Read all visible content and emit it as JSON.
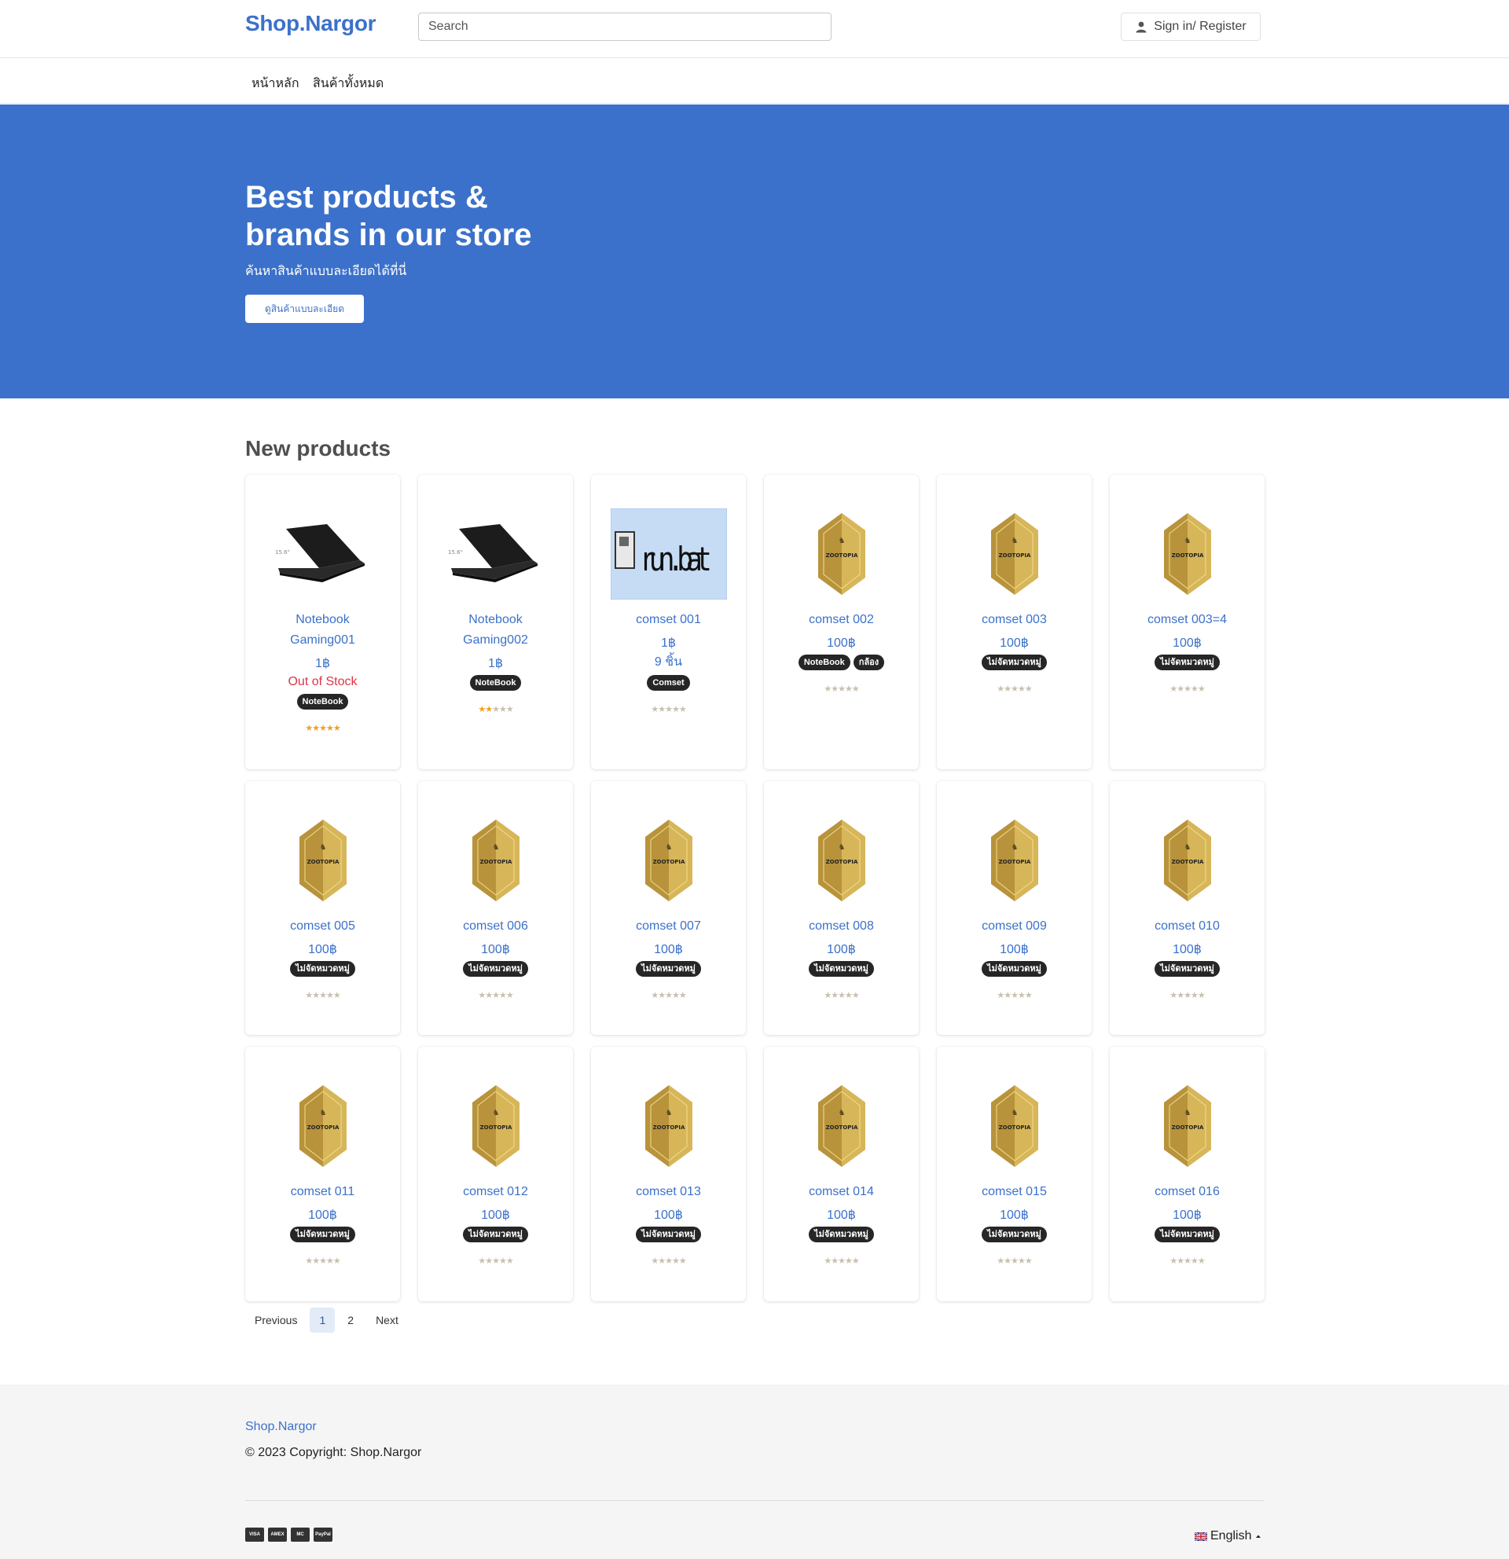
{
  "header": {
    "brand": "Shop.Nargor",
    "search_placeholder": "Search",
    "signin_label": "Sign in/ Register"
  },
  "nav": {
    "items": [
      "หน้าหลัก",
      "สินค้าทั้งหมด"
    ]
  },
  "hero": {
    "title": "Best products & brands in our store",
    "subtitle": "ค้นหาสินค้าแบบละเอียดได้ที่นี่",
    "cta_label": "ดูสินค้าแบบละเอียด"
  },
  "products": {
    "title": "New products",
    "items": [
      {
        "name": "Notebook Gaming001",
        "price": "1฿",
        "status": "Out of Stock",
        "tags": [
          "NoteBook"
        ],
        "rating": 5,
        "image": "laptop-image"
      },
      {
        "name": "Notebook Gaming002",
        "price": "1฿",
        "tags": [
          "NoteBook"
        ],
        "rating": 2,
        "image": "laptop-image"
      },
      {
        "name": "comset 001",
        "price": "1฿",
        "qty": "9 ชิ้น",
        "tags": [
          "Comset"
        ],
        "rating": 0,
        "image": "run-bat-image",
        "image_text": "run.bat"
      },
      {
        "name": "comset 002",
        "price": "100฿",
        "tags": [
          "NoteBook",
          "กล้อง"
        ],
        "rating": 0,
        "image": "zootopia-badge-image"
      },
      {
        "name": "comset 003",
        "price": "100฿",
        "tags": [
          "ไม่จัดหมวดหมู่"
        ],
        "rating": 0,
        "image": "zootopia-badge-image"
      },
      {
        "name": "comset 003=4",
        "price": "100฿",
        "tags": [
          "ไม่จัดหมวดหมู่"
        ],
        "rating": 0,
        "image": "zootopia-badge-image"
      },
      {
        "name": "comset 005",
        "price": "100฿",
        "tags": [
          "ไม่จัดหมวดหมู่"
        ],
        "rating": 0,
        "image": "zootopia-badge-image"
      },
      {
        "name": "comset 006",
        "price": "100฿",
        "tags": [
          "ไม่จัดหมวดหมู่"
        ],
        "rating": 0,
        "image": "zootopia-badge-image"
      },
      {
        "name": "comset 007",
        "price": "100฿",
        "tags": [
          "ไม่จัดหมวดหมู่"
        ],
        "rating": 0,
        "image": "zootopia-badge-image"
      },
      {
        "name": "comset 008",
        "price": "100฿",
        "tags": [
          "ไม่จัดหมวดหมู่"
        ],
        "rating": 0,
        "image": "zootopia-badge-image"
      },
      {
        "name": "comset 009",
        "price": "100฿",
        "tags": [
          "ไม่จัดหมวดหมู่"
        ],
        "rating": 0,
        "image": "zootopia-badge-image"
      },
      {
        "name": "comset 010",
        "price": "100฿",
        "tags": [
          "ไม่จัดหมวดหมู่"
        ],
        "rating": 0,
        "image": "zootopia-badge-image"
      },
      {
        "name": "comset 011",
        "price": "100฿",
        "tags": [
          "ไม่จัดหมวดหมู่"
        ],
        "rating": 0,
        "image": "zootopia-badge-image"
      },
      {
        "name": "comset 012",
        "price": "100฿",
        "tags": [
          "ไม่จัดหมวดหมู่"
        ],
        "rating": 0,
        "image": "zootopia-badge-image"
      },
      {
        "name": "comset 013",
        "price": "100฿",
        "tags": [
          "ไม่จัดหมวดหมู่"
        ],
        "rating": 0,
        "image": "zootopia-badge-image"
      },
      {
        "name": "comset 014",
        "price": "100฿",
        "tags": [
          "ไม่จัดหมวดหมู่"
        ],
        "rating": 0,
        "image": "zootopia-badge-image"
      },
      {
        "name": "comset 015",
        "price": "100฿",
        "tags": [
          "ไม่จัดหมวดหมู่"
        ],
        "rating": 0,
        "image": "zootopia-badge-image"
      },
      {
        "name": "comset 016",
        "price": "100฿",
        "tags": [
          "ไม่จัดหมวดหมู่"
        ],
        "rating": 0,
        "image": "zootopia-badge-image"
      }
    ]
  },
  "pagination": {
    "previous": "Previous",
    "pages": [
      "1",
      "2"
    ],
    "active_page": "1",
    "next": "Next"
  },
  "footer": {
    "brand": "Shop.Nargor",
    "copyright": "© 2023 Copyright: Shop.Nargor",
    "payment_icons": [
      "VISA",
      "AMEX",
      "MC",
      "PayPal"
    ],
    "language": "English"
  },
  "colors": {
    "accent": "#3b71ca",
    "out_of_stock": "#dc3545",
    "tag_bg": "#262626",
    "star_active": "#f0a020"
  }
}
